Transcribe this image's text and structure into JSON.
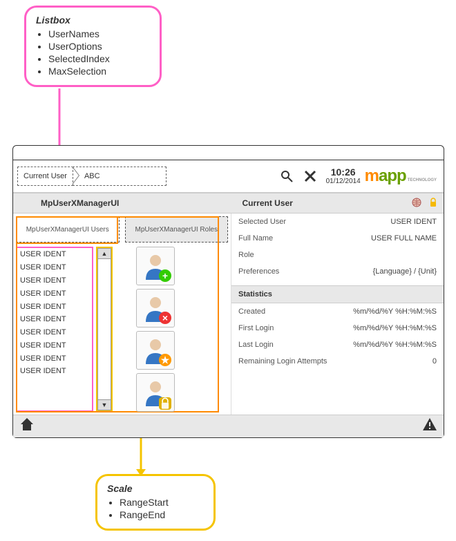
{
  "callout_listbox": {
    "title": "Listbox",
    "items": [
      "UserNames",
      "UserOptions",
      "SelectedIndex",
      "MaxSelection"
    ]
  },
  "callout_scale": {
    "title": "Scale",
    "items": [
      "RangeStart",
      "RangeEnd"
    ]
  },
  "header": {
    "breadcrumb_current": "Current User",
    "breadcrumb_value": "ABC",
    "time": "10:26",
    "date": "01/12/2014",
    "logo_m": "m",
    "logo_app": "app",
    "logo_tech": "TECHNOLOGY"
  },
  "subheader": {
    "left_title": "MpUserXManagerUI",
    "right_title": "Current User"
  },
  "tabs": {
    "users": "MpUserXManagerUI Users",
    "roles": "MpUserXManagerUI Roles"
  },
  "listbox_items": [
    "USER IDENT",
    "USER IDENT",
    "USER IDENT",
    "USER IDENT",
    "USER IDENT",
    "USER IDENT",
    "USER IDENT",
    "USER IDENT",
    "USER IDENT",
    "USER IDENT"
  ],
  "scroll": {
    "up": "▲",
    "down": "▼"
  },
  "detail": {
    "selected_user_k": "Selected User",
    "selected_user_v": "USER IDENT",
    "full_name_k": "Full Name",
    "full_name_v": "USER FULL NAME",
    "role_k": "Role",
    "role_v": "",
    "prefs_k": "Preferences",
    "prefs_v": "{Language} / {Unit}",
    "stats_hdr": "Statistics",
    "created_k": "Created",
    "created_v": "%m/%d/%Y %H:%M:%S",
    "first_login_k": "First Login",
    "first_login_v": "%m/%d/%Y %H:%M:%S",
    "last_login_k": "Last Login",
    "last_login_v": "%m/%d/%Y %H:%M:%S",
    "remaining_k": "Remaining Login Attempts",
    "remaining_v": "0"
  },
  "icons": {
    "search": "🔍",
    "tools": "✖",
    "home": "🏠",
    "warn": "▲",
    "globe": "🌐",
    "lock": "🔒"
  }
}
